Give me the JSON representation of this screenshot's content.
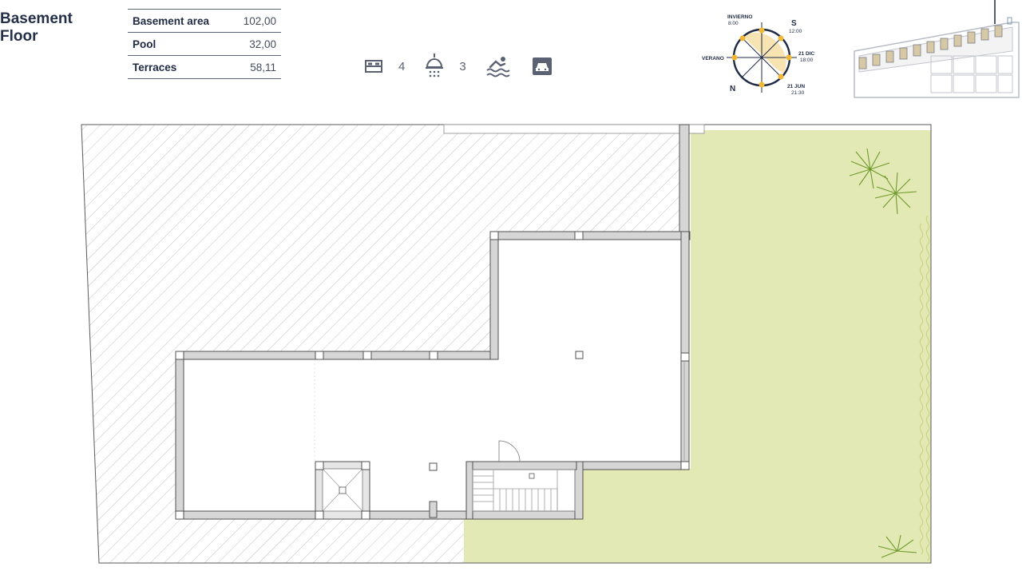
{
  "header": {
    "title_line1": "Basement",
    "title_line2": "Floor"
  },
  "areas": [
    {
      "label": "Basement area",
      "value": "102,00"
    },
    {
      "label": "Pool",
      "value": "32,00"
    },
    {
      "label": "Terraces",
      "value": "58,11"
    }
  ],
  "features": {
    "bedrooms": {
      "icon": "bed-icon",
      "count": "4"
    },
    "bathrooms": {
      "icon": "shower-icon",
      "count": "3"
    },
    "pool": {
      "icon": "swimming-pool-icon"
    },
    "garage": {
      "icon": "garage-icon"
    }
  },
  "compass": {
    "south": "S",
    "north": "N",
    "invierno": "INVIERNO",
    "invierno_time": "8:00",
    "s_time": "12:00",
    "verano": "VERANO",
    "dic": "21 DIC",
    "dic_time": "18:00",
    "jun": "21 JUN",
    "jun_time": "21:30"
  },
  "colors": {
    "text": "#1f2a44",
    "garden": "#e3e9b4",
    "wall": "#d6d6d6",
    "sun": "#f2b733",
    "icon": "#5a6173"
  }
}
